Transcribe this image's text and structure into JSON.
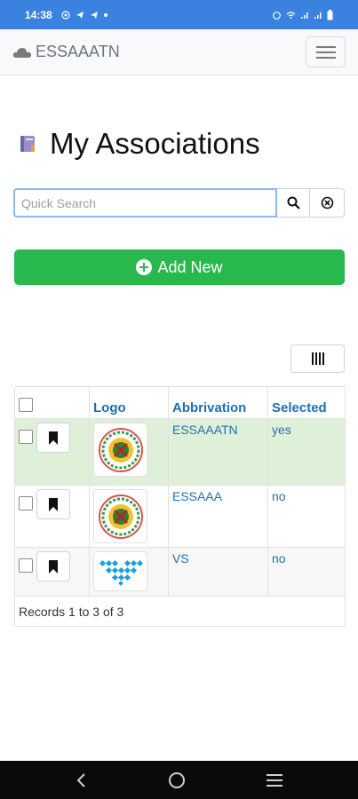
{
  "status_bar": {
    "time": "14:38",
    "left_icons": [
      "whatsapp-icon",
      "telegram-icon",
      "telegram-icon",
      "dot"
    ],
    "right_icons": [
      "alarm-icon",
      "wifi-icon",
      "signal-icon",
      "signal-icon",
      "battery-icon"
    ],
    "bg_color": "#3b82e0"
  },
  "navbar": {
    "brand": "ESSAAATN",
    "brand_icon": "cloud-icon",
    "menu_icon": "hamburger-icon"
  },
  "page": {
    "title": "My Associations",
    "title_icon": "book-icon"
  },
  "search": {
    "placeholder": "Quick Search",
    "value": "",
    "search_icon": "search-icon",
    "clear_icon": "clear-circle-icon"
  },
  "add_button": {
    "label": "Add New",
    "icon": "plus-circle-icon",
    "color": "#28b84d"
  },
  "columns_button": {
    "icon": "columns-icon"
  },
  "table": {
    "headers": [
      "",
      "Logo",
      "Abbrivation",
      "Selected"
    ],
    "rows": [
      {
        "abbreviation": "ESSAAATN",
        "selected": "yes",
        "logo": "association-seal-logo",
        "highlighted": true
      },
      {
        "abbreviation": "ESSAAA",
        "selected": "no",
        "logo": "association-seal-logo",
        "highlighted": false
      },
      {
        "abbreviation": "VS",
        "selected": "no",
        "logo": "vs-dots-logo",
        "highlighted": false
      }
    ],
    "footer": "Records 1 to 3 of 3",
    "link_color": "#1f6fb2",
    "selected_row_color": "#dff0d8"
  },
  "system_nav": {
    "icons": [
      "back-icon",
      "home-icon",
      "recents-icon"
    ]
  }
}
